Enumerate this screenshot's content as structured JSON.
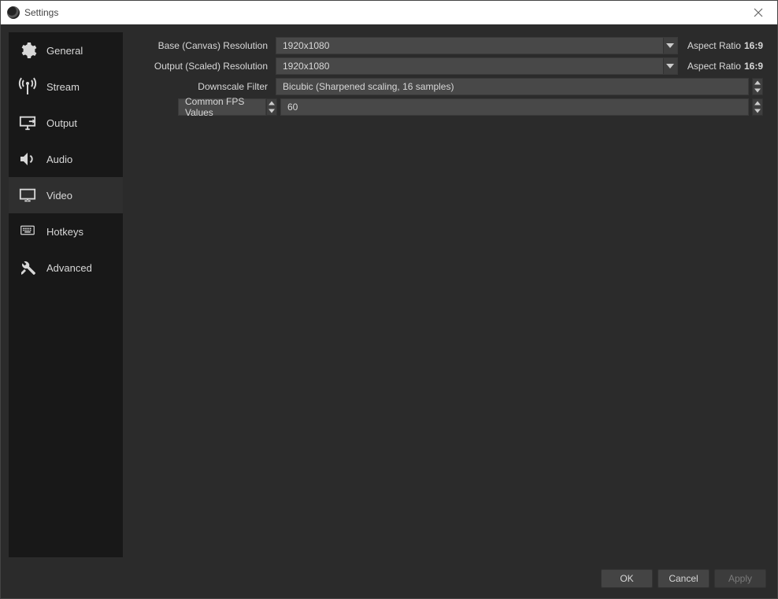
{
  "window": {
    "title": "Settings"
  },
  "sidebar": {
    "items": [
      {
        "id": "general",
        "label": "General"
      },
      {
        "id": "stream",
        "label": "Stream"
      },
      {
        "id": "output",
        "label": "Output"
      },
      {
        "id": "audio",
        "label": "Audio"
      },
      {
        "id": "video",
        "label": "Video"
      },
      {
        "id": "hotkeys",
        "label": "Hotkeys"
      },
      {
        "id": "advanced",
        "label": "Advanced"
      }
    ],
    "active": "video"
  },
  "video": {
    "base_label": "Base (Canvas) Resolution",
    "base_value": "1920x1080",
    "base_ratio_label": "Aspect Ratio",
    "base_ratio_value": "16:9",
    "output_label": "Output (Scaled) Resolution",
    "output_value": "1920x1080",
    "output_ratio_label": "Aspect Ratio",
    "output_ratio_value": "16:9",
    "filter_label": "Downscale Filter",
    "filter_value": "Bicubic (Sharpened scaling, 16 samples)",
    "fps_mode_label": "Common FPS Values",
    "fps_value": "60"
  },
  "buttons": {
    "ok": "OK",
    "cancel": "Cancel",
    "apply": "Apply"
  }
}
